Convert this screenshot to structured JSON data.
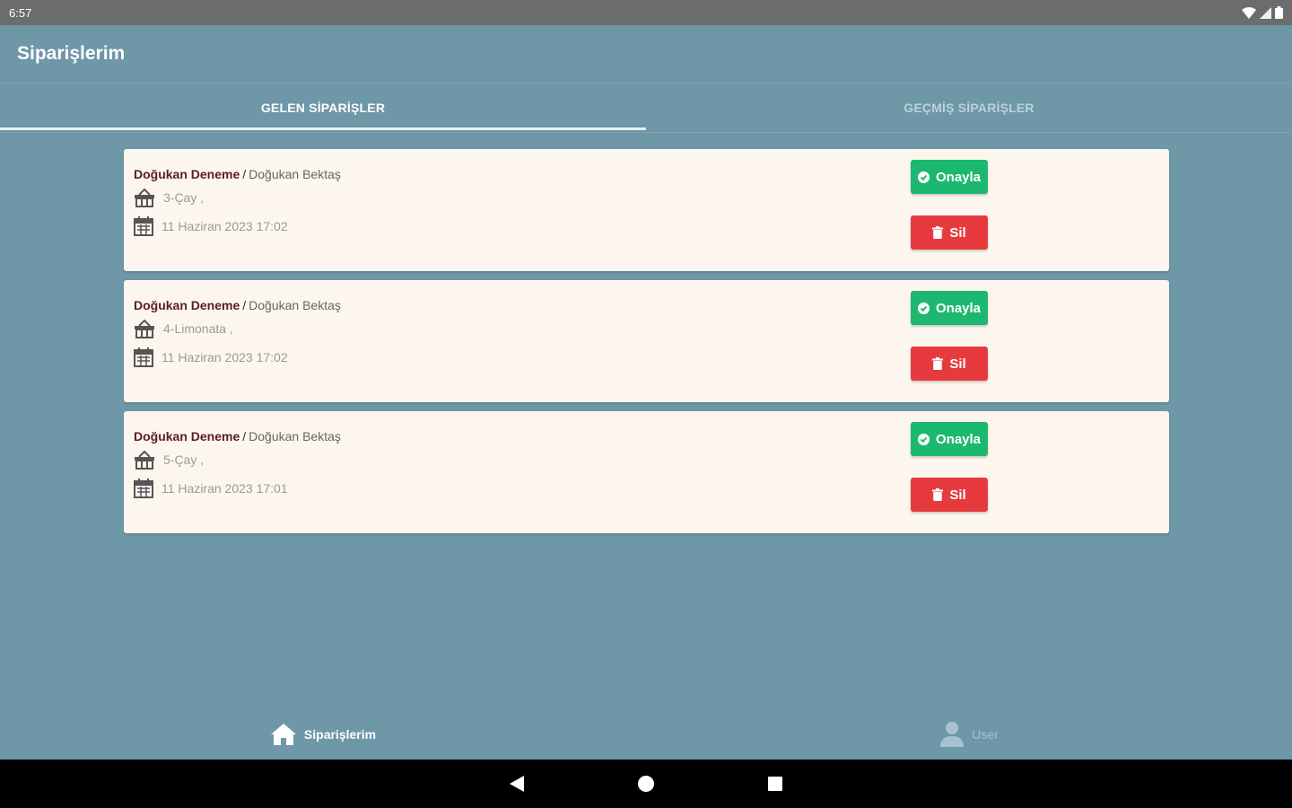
{
  "status_bar": {
    "time": "6:57"
  },
  "app_bar": {
    "title": "Siparişlerim"
  },
  "tabs": [
    {
      "label": "GELEN SİPARİŞLER",
      "active": true
    },
    {
      "label": "GEÇMİŞ SİPARİŞLER",
      "active": false
    }
  ],
  "orders": [
    {
      "customer": "Doğukan  Deneme",
      "separator": "/",
      "staff": "Doğukan Bektaş",
      "product": "3-Çay ,",
      "date": "11 Haziran 2023 17:02",
      "approve_label": "Onayla",
      "delete_label": "Sil"
    },
    {
      "customer": "Doğukan  Deneme",
      "separator": "/",
      "staff": "Doğukan Bektaş",
      "product": "4-Limonata ,",
      "date": "11 Haziran 2023 17:02",
      "approve_label": "Onayla",
      "delete_label": "Sil"
    },
    {
      "customer": "Doğukan  Deneme",
      "separator": "/",
      "staff": "Doğukan Bektaş",
      "product": "5-Çay ,",
      "date": "11 Haziran 2023 17:01",
      "approve_label": "Onayla",
      "delete_label": "Sil"
    }
  ],
  "bottom_nav": [
    {
      "label": "Siparişlerim",
      "icon": "home-icon",
      "active": true
    },
    {
      "label": "User",
      "icon": "user-icon",
      "active": false
    }
  ],
  "colors": {
    "background": "#6e97a8",
    "card": "#fcf6ee",
    "approve": "#1cb86f",
    "delete": "#e63a3e",
    "status_bar": "#6c6c6c"
  }
}
